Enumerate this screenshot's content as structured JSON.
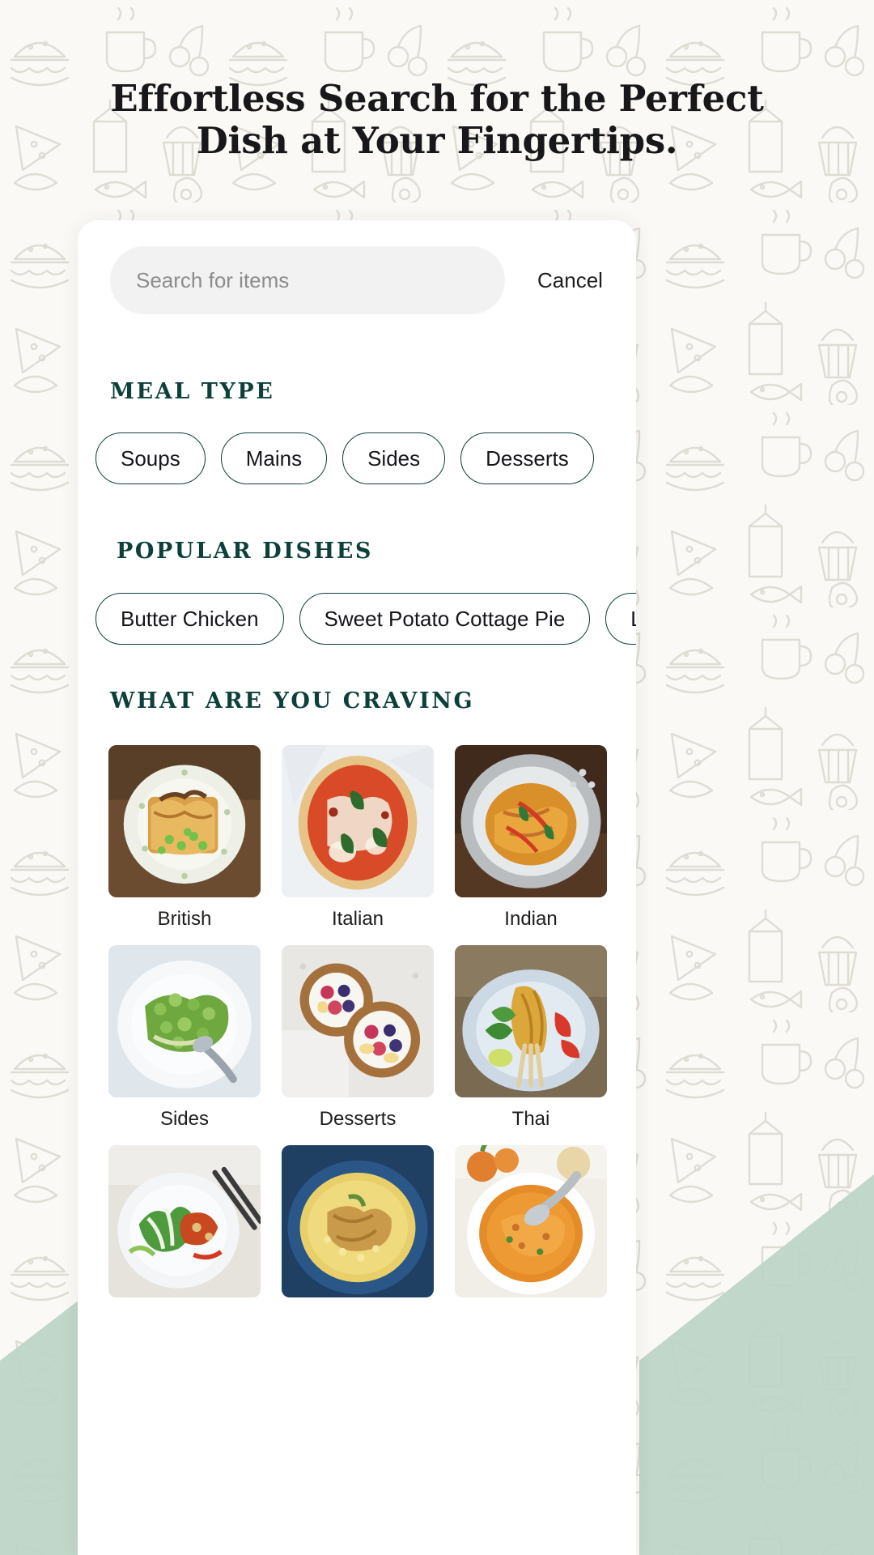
{
  "page": {
    "headline_line1": "Effortless Search for the Perfect",
    "headline_line2": "Dish at Your Fingertips.",
    "background_color": "#faf9f6",
    "accent_color": "#0d403a",
    "sage_color": "#b9d2c2",
    "card_color": "#ffffff"
  },
  "search": {
    "placeholder": "Search for items",
    "value": "",
    "cancel_label": "Cancel"
  },
  "meal_type": {
    "heading": "MEAL TYPE",
    "chips": [
      {
        "label": "Soups"
      },
      {
        "label": "Mains"
      },
      {
        "label": "Sides"
      },
      {
        "label": "Desserts"
      }
    ]
  },
  "popular_dishes": {
    "heading": "POPULAR DISHES",
    "chips": [
      {
        "label": "Butter Chicken"
      },
      {
        "label": "Sweet Potato Cottage Pie"
      },
      {
        "label": "La"
      }
    ]
  },
  "craving": {
    "heading": "WHAT ARE YOU CRAVING",
    "items": [
      {
        "label": "British",
        "image": "cottage-pie-on-floral-plate"
      },
      {
        "label": "Italian",
        "image": "margherita-pizza"
      },
      {
        "label": "Indian",
        "image": "curry-in-bowl"
      },
      {
        "label": "Sides",
        "image": "green-salad-plate"
      },
      {
        "label": "Desserts",
        "image": "fruit-tarts"
      },
      {
        "label": "Thai",
        "image": "satay-skewers"
      },
      {
        "label": "",
        "image": "bok-choy-rice-bowl"
      },
      {
        "label": "",
        "image": "chicken-corn-soup"
      },
      {
        "label": "",
        "image": "lentil-soup-bowl"
      }
    ]
  }
}
